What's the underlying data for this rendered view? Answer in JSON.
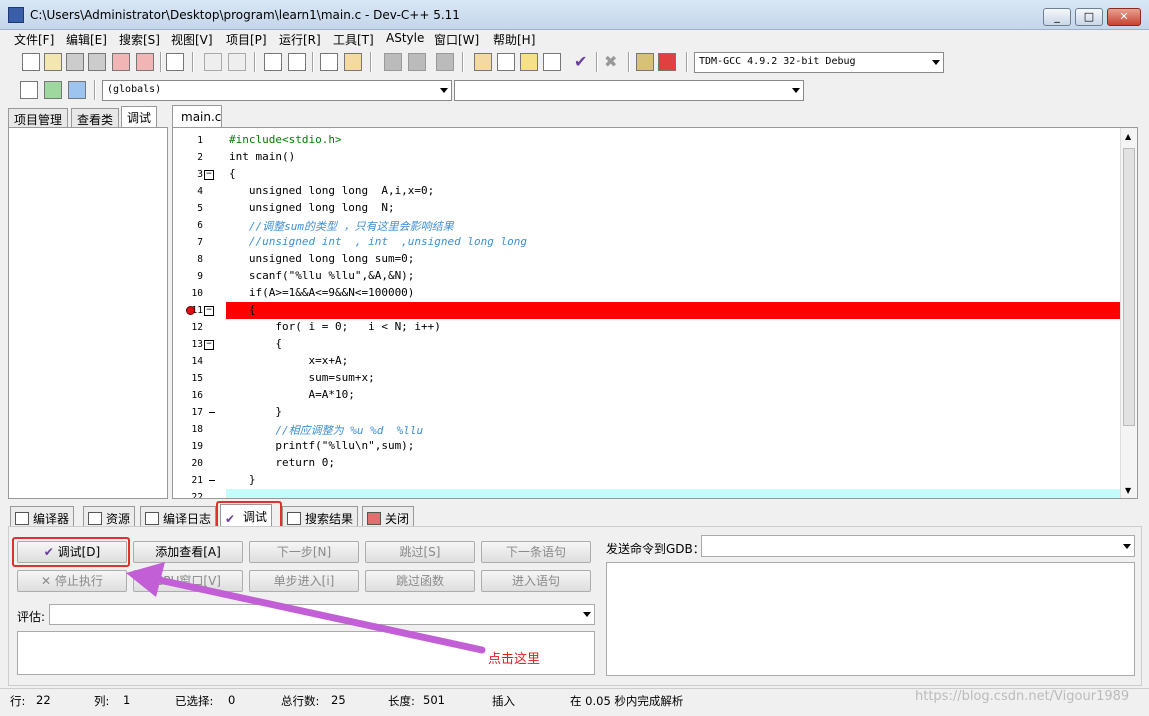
{
  "window": {
    "title": "C:\\Users\\Administrator\\Desktop\\program\\learn1\\main.c - Dev-C++ 5.11",
    "min": "_",
    "max": "□",
    "close": "✕"
  },
  "menu": [
    "文件[F]",
    "编辑[E]",
    "搜索[S]",
    "视图[V]",
    "项目[P]",
    "运行[R]",
    "工具[T]",
    "AStyle",
    "窗口[W]",
    "帮助[H]"
  ],
  "toolbar": {
    "compiler_select": "TDM-GCC 4.9.2 32-bit Debug",
    "scope_select": "(globals)",
    "symbol_select": ""
  },
  "left_tabs": [
    "项目管理",
    "查看类",
    "调试"
  ],
  "editor": {
    "tab": "main.c",
    "lines": [
      {
        "n": "1",
        "code": "#include<stdio.h>"
      },
      {
        "n": "2",
        "code": "int main()"
      },
      {
        "n": "3",
        "code": "{"
      },
      {
        "n": "4",
        "code": "   unsigned long long  A,i,x=0;"
      },
      {
        "n": "5",
        "code": "   unsigned long long  N;"
      },
      {
        "n": "6",
        "code": "   //调整sum的类型 ，只有这里会影响结果"
      },
      {
        "n": "7",
        "code": "   //unsigned int  , int  ,unsigned long long"
      },
      {
        "n": "8",
        "code": "   unsigned long long sum=0;"
      },
      {
        "n": "9",
        "code": "   scanf(\"%llu %llu\",&A,&N);"
      },
      {
        "n": "10",
        "code": "   if(A>=1&&A<=9&&N<=100000)"
      },
      {
        "n": "11",
        "code": "   {"
      },
      {
        "n": "12",
        "code": "       for( i = 0;   i < N; i++)"
      },
      {
        "n": "13",
        "code": "       {"
      },
      {
        "n": "14",
        "code": "            x=x+A;"
      },
      {
        "n": "15",
        "code": "            sum=sum+x;"
      },
      {
        "n": "16",
        "code": "            A=A*10;"
      },
      {
        "n": "17",
        "code": "       }"
      },
      {
        "n": "18",
        "code": "       //相应调整为 %u %d  %llu"
      },
      {
        "n": "19",
        "code": "       printf(\"%llu\\n\",sum);"
      },
      {
        "n": "20",
        "code": "       return 0;"
      },
      {
        "n": "21",
        "code": "   }"
      },
      {
        "n": "22",
        "code": ""
      }
    ]
  },
  "bottom_tabs": [
    "编译器",
    "资源",
    "编译日志",
    "调试",
    "搜索结果",
    "关闭"
  ],
  "debug": {
    "buttons_row1": [
      "调试[D]",
      "添加查看[A]",
      "下一步[N]",
      "跳过[S]",
      "下一条语句"
    ],
    "buttons_row2": [
      "停止执行",
      "CPU窗口[V]",
      "单步进入[i]",
      "跳过函数",
      "进入语句"
    ],
    "eval_label": "评估:",
    "gdb_label": "发送命令到GDB：",
    "annotation": "点击这里"
  },
  "status": {
    "row_label": "行:",
    "row": "22",
    "col_label": "列:",
    "col": "1",
    "sel_label": "已选择:",
    "sel": "0",
    "total_label": "总行数:",
    "total": "25",
    "len_label": "长度:",
    "len": "501",
    "mode": "插入",
    "parse": "在 0.05 秒内完成解析"
  },
  "watermark": "https://blog.csdn.net/Vigour1989",
  "colors": {
    "breakpoint_line": "#ff0000",
    "current_line": "#c6fbfc",
    "keyword": "#000000",
    "string": "#ff0000",
    "comment": "#3d8fd6",
    "preproc": "#008000",
    "number": "#ff0000",
    "highlight_box": "#e03030",
    "arrow": "#c25fd6"
  }
}
